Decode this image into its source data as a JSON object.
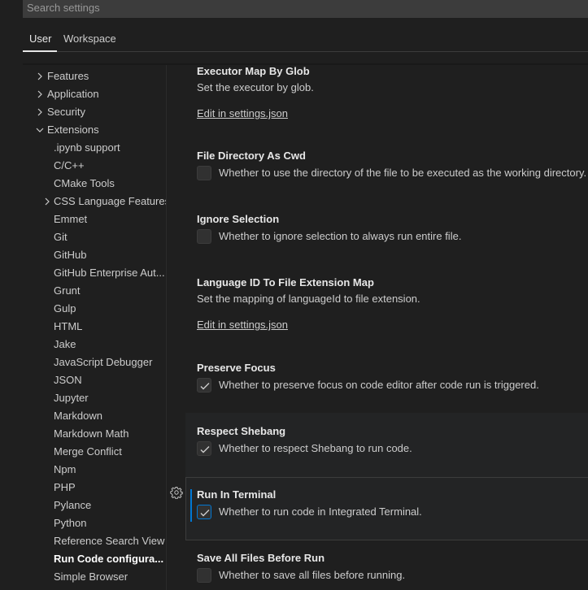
{
  "search": {
    "placeholder": "Search settings"
  },
  "tabs": [
    {
      "label": "User",
      "active": true
    },
    {
      "label": "Workspace",
      "active": false
    }
  ],
  "toc": {
    "items": [
      {
        "label": "Features",
        "chevron": "right",
        "level": 0
      },
      {
        "label": "Application",
        "chevron": "right",
        "level": 0
      },
      {
        "label": "Security",
        "chevron": "right",
        "level": 0
      },
      {
        "label": "Extensions",
        "chevron": "down",
        "level": 0
      },
      {
        "label": ".ipynb support",
        "level": 1
      },
      {
        "label": "C/C++",
        "level": 1
      },
      {
        "label": "CMake Tools",
        "level": 1
      },
      {
        "label": "CSS Language Features",
        "chevron": "right",
        "level": 1
      },
      {
        "label": "Emmet",
        "level": 1
      },
      {
        "label": "Git",
        "level": 1
      },
      {
        "label": "GitHub",
        "level": 1
      },
      {
        "label": "GitHub Enterprise Aut...",
        "level": 1
      },
      {
        "label": "Grunt",
        "level": 1
      },
      {
        "label": "Gulp",
        "level": 1
      },
      {
        "label": "HTML",
        "level": 1
      },
      {
        "label": "Jake",
        "level": 1
      },
      {
        "label": "JavaScript Debugger",
        "level": 1
      },
      {
        "label": "JSON",
        "level": 1
      },
      {
        "label": "Jupyter",
        "level": 1
      },
      {
        "label": "Markdown",
        "level": 1
      },
      {
        "label": "Markdown Math",
        "level": 1
      },
      {
        "label": "Merge Conflict",
        "level": 1
      },
      {
        "label": "Npm",
        "level": 1
      },
      {
        "label": "PHP",
        "level": 1
      },
      {
        "label": "Pylance",
        "level": 1
      },
      {
        "label": "Python",
        "level": 1
      },
      {
        "label": "Reference Search View",
        "level": 1
      },
      {
        "label": "Run Code configura...",
        "level": 1,
        "selected": true
      },
      {
        "label": "Simple Browser",
        "level": 1
      }
    ]
  },
  "settings": [
    {
      "title": "Executor Map By Glob",
      "description": "Set the executor by glob.",
      "link": "Edit in settings.json"
    },
    {
      "title": "File Directory As Cwd",
      "checkbox_label": "Whether to use the directory of the file to be executed as the working directory.",
      "checked": false
    },
    {
      "title": "Ignore Selection",
      "checkbox_label": "Whether to ignore selection to always run entire file.",
      "checked": false
    },
    {
      "title": "Language ID To File Extension Map",
      "description": "Set the mapping of languageId to file extension.",
      "link": "Edit in settings.json"
    },
    {
      "title": "Preserve Focus",
      "checkbox_label": "Whether to preserve focus on code editor after code run is triggered.",
      "checked": true
    },
    {
      "title": "Respect Shebang",
      "checkbox_label": "Whether to respect Shebang to run code.",
      "checked": true
    },
    {
      "title": "Run In Terminal",
      "checkbox_label": "Whether to run code in Integrated Terminal.",
      "checked": true,
      "focused": true
    },
    {
      "title": "Save All Files Before Run",
      "checkbox_label": "Whether to save all files before running.",
      "checked": false
    }
  ],
  "colors": {
    "focus_accent": "#0078d4"
  }
}
